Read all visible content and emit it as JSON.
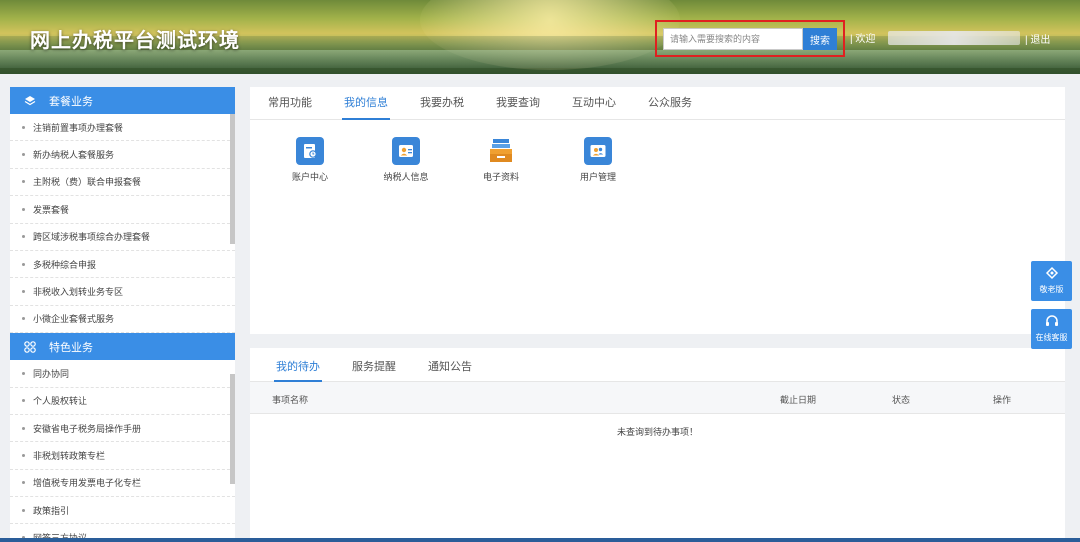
{
  "header": {
    "title": "网上办税平台测试环境",
    "search_placeholder": "请输入需要搜索的内容",
    "search_button": "搜索",
    "user_label": "| 欢迎",
    "logout": "| 退出"
  },
  "sidebar": {
    "section1": {
      "title": "套餐业务",
      "items": [
        {
          "label": "注销前置事项办理套餐"
        },
        {
          "label": "新办纳税人套餐服务"
        },
        {
          "label": "主附税（费）联合申报套餐"
        },
        {
          "label": "发票套餐"
        },
        {
          "label": "跨区域涉税事项综合办理套餐"
        },
        {
          "label": "多税种综合申报"
        },
        {
          "label": "非税收入划转业务专区"
        },
        {
          "label": "小微企业套餐式服务"
        }
      ]
    },
    "section2": {
      "title": "特色业务",
      "items": [
        {
          "label": "同办协同"
        },
        {
          "label": "个人股权转让"
        },
        {
          "label": "安徽省电子税务局操作手册"
        },
        {
          "label": "非税划转政策专栏"
        },
        {
          "label": "增值税专用发票电子化专栏"
        },
        {
          "label": "政策指引"
        },
        {
          "label": "网签三方协议"
        }
      ]
    }
  },
  "main": {
    "tabs": [
      "常用功能",
      "我的信息",
      "我要办税",
      "我要查询",
      "互动中心",
      "公众服务"
    ],
    "active_tab": "我的信息",
    "apps": [
      {
        "label": "账户中心",
        "icon": "account-center-icon"
      },
      {
        "label": "纳税人信息",
        "icon": "taxpayer-info-icon"
      },
      {
        "label": "电子资料",
        "icon": "e-documents-icon"
      },
      {
        "label": "用户管理",
        "icon": "user-management-icon"
      }
    ]
  },
  "todo": {
    "tabs": [
      "我的待办",
      "服务提醒",
      "通知公告"
    ],
    "active_tab": "我的待办",
    "columns": {
      "name": "事项名称",
      "deadline": "截止日期",
      "status": "状态",
      "action": "操作"
    },
    "empty_message": "未查询到待办事项！"
  },
  "floating": {
    "elder_mode": "敬老版",
    "online_service": "在线客服"
  },
  "colors": {
    "accent": "#3a8ee6",
    "search_highlight": "#e02020"
  }
}
